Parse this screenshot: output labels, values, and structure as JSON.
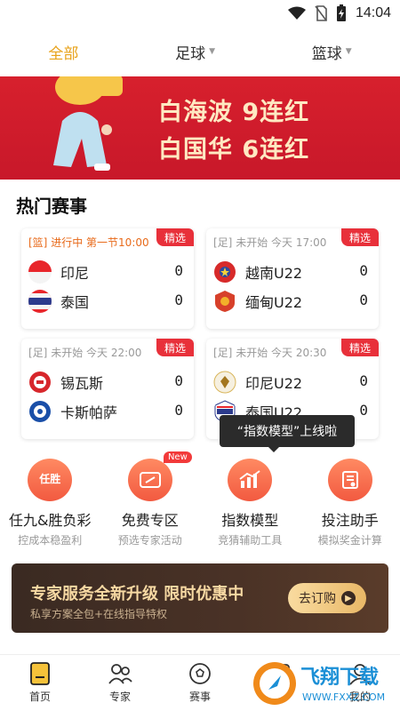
{
  "status_bar": {
    "time": "14:04"
  },
  "tabs": [
    {
      "label": "全部",
      "active": true
    },
    {
      "label": "足球",
      "dropdown": true
    },
    {
      "label": "篮球",
      "dropdown": true
    }
  ],
  "banner": {
    "line1": "白海波 9连红",
    "line2": "白国华 6连红"
  },
  "hot_matches": {
    "title": "热门赛事",
    "cards": [
      {
        "tag": "[篮]",
        "status": "进行中",
        "time": "第一节10:00",
        "badge": "精选",
        "team1": "印尼",
        "score1": "0",
        "team2": "泰国",
        "score2": "0"
      },
      {
        "tag": "[足]",
        "status": "未开始",
        "time": "今天 17:00",
        "badge": "精选",
        "team1": "越南U22",
        "score1": "0",
        "team2": "缅甸U22",
        "score2": "0"
      },
      {
        "tag": "[足]",
        "status": "未开始",
        "time": "今天 22:00",
        "badge": "精选",
        "team1": "锡瓦斯",
        "score1": "0",
        "team2": "卡斯帕萨",
        "score2": "0"
      },
      {
        "tag": "[足]",
        "status": "未开始",
        "time": "今天 20:30",
        "badge": "精选",
        "team1": "印尼U22",
        "score1": "0",
        "team2": "泰国U22",
        "score2": "0"
      }
    ]
  },
  "tooltip": "“指数模型”上线啦",
  "features": [
    {
      "name": "任九&胜负彩",
      "desc": "控成本稳盈利",
      "icon": "ren-sheng-icon",
      "icon_text": "任胜"
    },
    {
      "name": "免费专区",
      "desc": "预选专家活动",
      "icon": "ticket-icon",
      "new_badge": "New"
    },
    {
      "name": "指数模型",
      "desc": "竞猜辅助工具",
      "icon": "chart-icon"
    },
    {
      "name": "投注助手",
      "desc": "模拟奖金计算",
      "icon": "betting-slip-icon"
    }
  ],
  "promo": {
    "title": "专家服务全新升级 限时优惠中",
    "subtitle": "私享方案全包+在线指导特权",
    "button": "去订购"
  },
  "bottom_nav": [
    {
      "label": "首页",
      "icon": "home-icon",
      "active": true
    },
    {
      "label": "专家",
      "icon": "experts-icon"
    },
    {
      "label": "赛事",
      "icon": "football-icon"
    },
    {
      "label": "",
      "icon": "data-icon"
    },
    {
      "label": "我的",
      "icon": "profile-icon"
    }
  ],
  "watermark": {
    "text": "飞翔下载",
    "url": "WWW.FXXZ.COM"
  },
  "colors": {
    "accent": "#e8a21a",
    "banner_red": "#d7202d",
    "badge_red": "#e8303a",
    "feature_orange": "#f25a40"
  }
}
